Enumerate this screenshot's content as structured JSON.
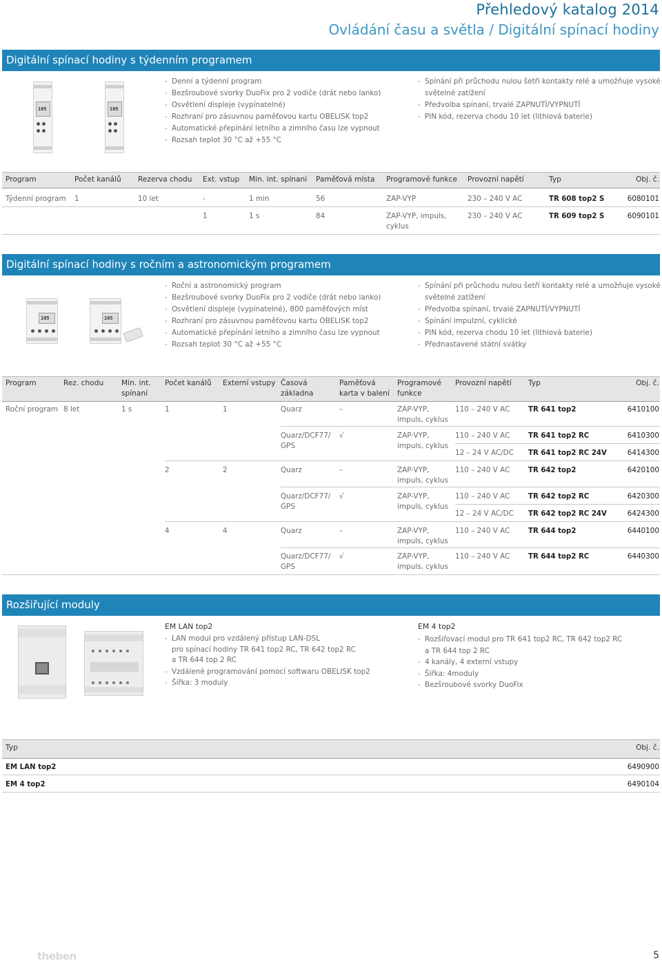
{
  "header": {
    "title": "Přehledový katalog 2014",
    "subtitle": "Ovládání času a světla / Digitální spínací hodiny"
  },
  "s1": {
    "title": "Digitální spínací hodiny s týdenním programem",
    "bullets_left": [
      "Denní a týdenní program",
      "Bezšroubové svorky DuoFix pro 2 vodiče (drát nebo lanko)",
      "Osvětlení displeje (vypínatelné)",
      "Rozhraní pro zásuvnou paměťovou kartu OBELISK top2",
      "Automatické přepínání letního a zimního času lze vypnout",
      "Rozsah teplot  30 °C až +55 °C"
    ],
    "bullets_right": [
      "Spínání při průchodu nulou šetří kontakty relé a umožňuje vysoké",
      "světelné zatížení",
      "Předvolba spínaní, trvalé ZAPNUTÍ/VYPNUTÍ",
      "PIN kód, rezerva chodu 10 let (lithiová baterie)"
    ],
    "cols": [
      "Program",
      "Počet kanálů",
      "Rezerva chodu",
      "Ext. vstup",
      "Min. int. spínaní",
      "Paměťová místa",
      "Programové funkce",
      "Provozní napětí",
      "Typ",
      "Obj. č."
    ],
    "rows": [
      [
        "Týdenní program",
        "1",
        "10 let",
        "-",
        "1 min",
        "56",
        "ZAP-VYP",
        "230 – 240 V AC",
        "TR 608 top2 S",
        "6080101"
      ],
      [
        "",
        "1",
        "",
        "",
        "1 s",
        "84",
        "ZAP-VYP, impuls,",
        "230 – 240 V AC",
        "TR 609 top2 S",
        "6090101"
      ]
    ],
    "row2_extra": "cyklus"
  },
  "s2": {
    "title": "Digitální spínací hodiny s ročním a astronomickým programem",
    "bullets_left": [
      "Roční a astronomický program",
      "Bezšroubové svorky DuoFix pro 2 vodiče (drát nebo lanko)",
      "Osvětlení displeje (vypínatelné), 800 paměťových míst",
      "Rozhraní pro zásuvnou paměťovou kartu OBELISK top2",
      "Automatické přepínání letního a zimního času lze vypnout",
      "Rozsah teplot  30 °C až +55 °C"
    ],
    "bullets_right": [
      "Spínání při průchodu nulou šetří kontakty relé a umožňuje vysoké",
      "světelné zatížení",
      "Předvolba spínaní, trvalé ZAPNUTÍ/VYPNUTÍ",
      "Spínání impulzní, cyklické",
      "PIN kód, rezerva chodu 10 let (lithiová baterie)",
      "Přednastavené státní svátky"
    ],
    "cols": [
      "Program",
      "Rez. chodu",
      "Min. int.",
      "spínaní",
      "Počet kanálů",
      "Externí vstupy",
      "Časová",
      "základna",
      "Paměťová",
      "karta v balení",
      "Programové",
      "funkce",
      "Provozní napětí",
      "Typ",
      "Obj. č."
    ],
    "program": "Roční program",
    "reserve": "8 let",
    "minint": "1 s",
    "ch": [
      "1",
      "2",
      "4"
    ],
    "ext": [
      "1",
      "2",
      "4"
    ],
    "quarz": "Quarz",
    "quarz_dcf": "Quarz/DCF77/",
    "gps": "GPS",
    "dash": "–",
    "check": "√",
    "func1": "ZAP-VYP,",
    "func2": "impuls, cyklus",
    "v110": "110 – 240 V AC",
    "v12": "12 – 24 V AC/DC",
    "types": [
      "TR 641 top2",
      "TR 641 top2 RC",
      "TR 641 top2 RC 24V",
      "TR 642 top2",
      "TR 642 top2 RC",
      "TR 642 top2 RC 24V",
      "TR 644 top2",
      "TR 644 top2 RC"
    ],
    "orders": [
      "6410100",
      "6410300",
      "6414300",
      "6420100",
      "6420300",
      "6424300",
      "6440100",
      "6440300"
    ]
  },
  "s3": {
    "title": "Rozšiřující moduly",
    "em_lan_title": "EM LAN top2",
    "em_lan_bullets": [
      "LAN modul pro vzdálený přístup LAN-DSL",
      "pro spínací hodiny TR 641 top2 RC, TR 642 top2 RC",
      "a TR 644 top 2 RC",
      "Vzdálené programování pomocí softwaru OBELISK top2",
      "Šířka: 3 moduly"
    ],
    "em4_title": "EM 4 top2",
    "em4_bullets": [
      "Rozšiřovací modul pro TR 641 top2 RC, TR 642 top2 RC",
      "a TR 644 top 2 RC",
      "4 kanály, 4 externí vstupy",
      "Šířka: 4moduly",
      "Bezšroubové svorky DuoFix"
    ],
    "cols": [
      "Typ",
      "Obj. č."
    ],
    "rows": [
      [
        "EM LAN top2",
        "6490900"
      ],
      [
        "EM 4 top2",
        "6490104"
      ]
    ]
  },
  "footer": {
    "logo": "theben",
    "page": "5"
  },
  "lcd_text": "105"
}
